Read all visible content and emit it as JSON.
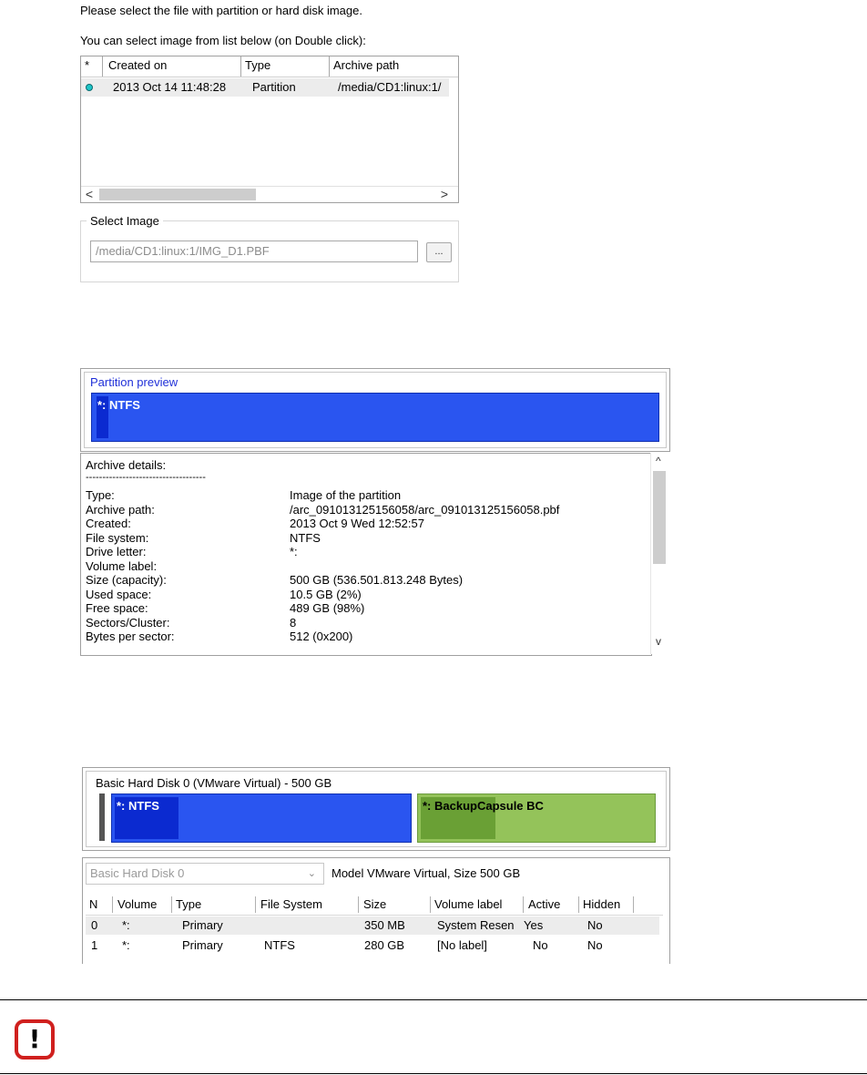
{
  "select_image_dialog": {
    "instruction_1": "Please select the file with partition or hard disk image.",
    "instruction_2": "You can select image from list below (on Double click):",
    "list": {
      "columns": [
        "*",
        "Created on",
        "Type",
        "Archive path"
      ],
      "rows": [
        {
          "created_on": "2013 Oct 14 11:48:28",
          "type": "Partition",
          "archive_path": "/media/CD1:linux:1/"
        }
      ]
    },
    "scroll_left": "<",
    "scroll_right": ">",
    "group_title": "Select Image",
    "path_value": "/media/CD1:linux:1/IMG_D1.PBF",
    "browse_label": "..."
  },
  "partition_preview": {
    "title": "Partition preview",
    "partition_label": "*: NTFS",
    "partition_color": "#2a55f0",
    "details_title": "Archive details:",
    "separator": "------------------------------------",
    "details": [
      {
        "key": "Type:",
        "value": "Image of the partition"
      },
      {
        "key": "Archive path:",
        "value": "/arc_091013125156058/arc_091013125156058.pbf"
      },
      {
        "key": "Created:",
        "value": "2013 Oct 9 Wed 12:52:57"
      },
      {
        "key": "File system:",
        "value": "NTFS"
      },
      {
        "key": "Drive letter:",
        "value": "*:"
      },
      {
        "key": "Volume label:",
        "value": ""
      },
      {
        "key": "Size (capacity):",
        "value": "500 GB (536.501.813.248 Bytes)"
      },
      {
        "key": "Used space:",
        "value": "10.5 GB (2%)"
      },
      {
        "key": "Free space:",
        "value": "489 GB (98%)"
      },
      {
        "key": "Sectors/Cluster:",
        "value": "8"
      },
      {
        "key": "Bytes per sector:",
        "value": "512 (0x200)"
      }
    ],
    "scroll_up": "^",
    "scroll_down": "v"
  },
  "disk_map": {
    "title": "Basic Hard Disk 0 (VMware Virtual) - 500 GB",
    "partitions": [
      {
        "label": "*: NTFS",
        "color": "#2a55f0"
      },
      {
        "label": "*: BackupCapsule BC",
        "color": "#94c35a"
      }
    ],
    "disk_select_value": "Basic Hard Disk 0",
    "model_info": "Model VMware Virtual, Size 500 GB",
    "columns": [
      "N",
      "Volume",
      "Type",
      "File System",
      "Size",
      "Volume label",
      "Active",
      "Hidden"
    ],
    "rows": [
      [
        "0",
        "*:",
        "Primary",
        "",
        "350 MB",
        "System Resen",
        "Yes",
        "No"
      ],
      [
        "1",
        "*:",
        "Primary",
        "NTFS",
        "280 GB",
        "[No label]",
        "No",
        "No"
      ]
    ]
  },
  "note": {
    "icon": "exclamation-warning-icon",
    "icon_color": "#d0201e",
    "icon_glyph": "!"
  }
}
